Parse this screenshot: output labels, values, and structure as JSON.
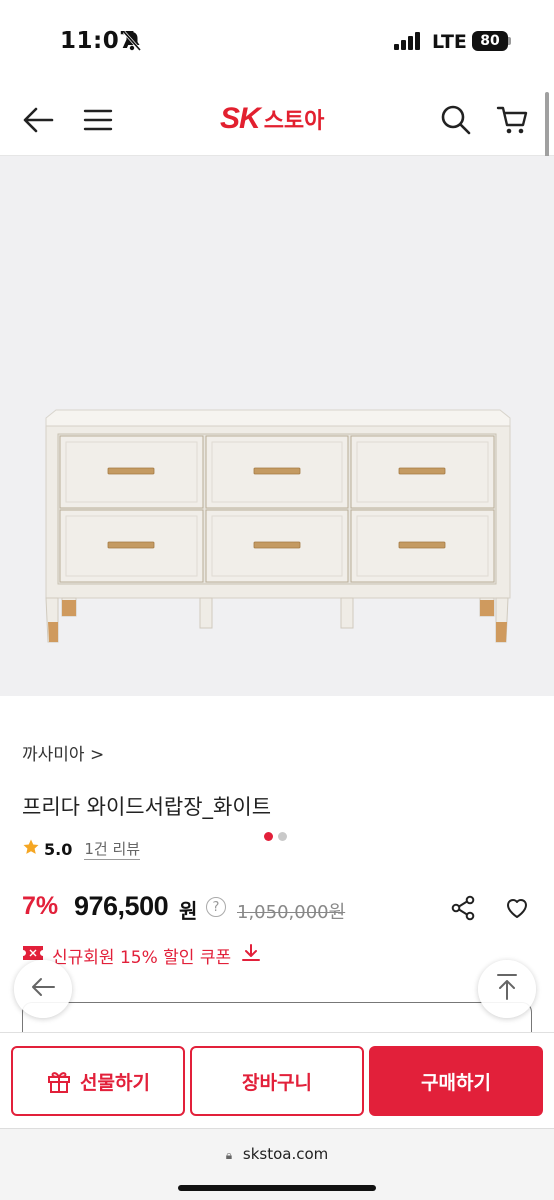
{
  "status": {
    "time": "11:07",
    "network": "LTE",
    "battery": "80"
  },
  "header": {
    "logo_sk": "SK",
    "logo_store": "스토아"
  },
  "product": {
    "brand": "까사미아",
    "brand_chevron": ">",
    "title": "프리다 와이드서랍장_화이트",
    "rating": "5.0",
    "review_count": "1건 리뷰",
    "discount": "7%",
    "price": "976,500",
    "currency": "원",
    "help": "?",
    "original_price": "1,050,000원",
    "coupon": "신규회원 15% 할인 쿠폰",
    "image_count": 2,
    "image_active_index": 0
  },
  "bottom": {
    "gift": "선물하기",
    "cart": "장바구니",
    "buy": "구매하기"
  },
  "browser": {
    "url": "skstoa.com"
  },
  "colors": {
    "accent": "#e2203a",
    "star": "#f5a623"
  }
}
